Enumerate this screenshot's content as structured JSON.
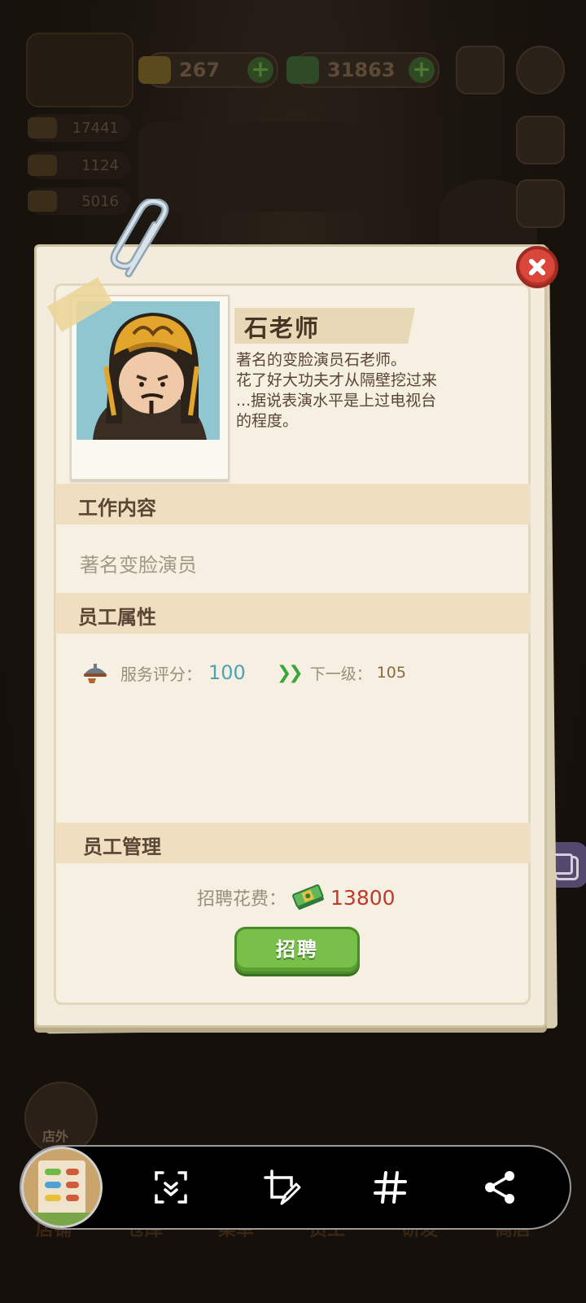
{
  "hud": {
    "diamond_count": "267",
    "cash_count": "31863",
    "stat_1": "17441",
    "stat_2": "1124",
    "stat_3": "5016"
  },
  "bottom_nav": {
    "items": [
      "店铺",
      "仓库",
      "菜单",
      "员工",
      "研发",
      "商店"
    ],
    "outside_label": "店外"
  },
  "dialog": {
    "staff_name": "石老师",
    "description": "著名的变脸演员石老师。\n花了好大功夫才从隔壁挖过来\n...据说表演水平是上过电视台\n的程度。",
    "work_section_title": "工作内容",
    "work_content": "著名变脸演员",
    "attr_section_title": "员工属性",
    "service_label": "服务评分：",
    "service_value": "100",
    "next_level_label": "下一级：",
    "next_level_value": "105",
    "manage_section_title": "员工管理",
    "hire_cost_label": "招聘花费：",
    "hire_cost_value": "13800",
    "hire_button": "招聘"
  },
  "colors": {
    "accent_green": "#78c04a",
    "cost_red": "#c0392b",
    "service_blue": "#4fa2b6",
    "close_red": "#d9473a"
  },
  "icons": [
    "clipboard-clip-icon",
    "close-icon",
    "service-bowl-icon",
    "next-level-arrows-icon",
    "cash-stack-icon",
    "scroll-capture-icon",
    "crop-edit-icon",
    "hashtag-icon",
    "share-icon",
    "settings-gear-icon",
    "camera-icon"
  ]
}
